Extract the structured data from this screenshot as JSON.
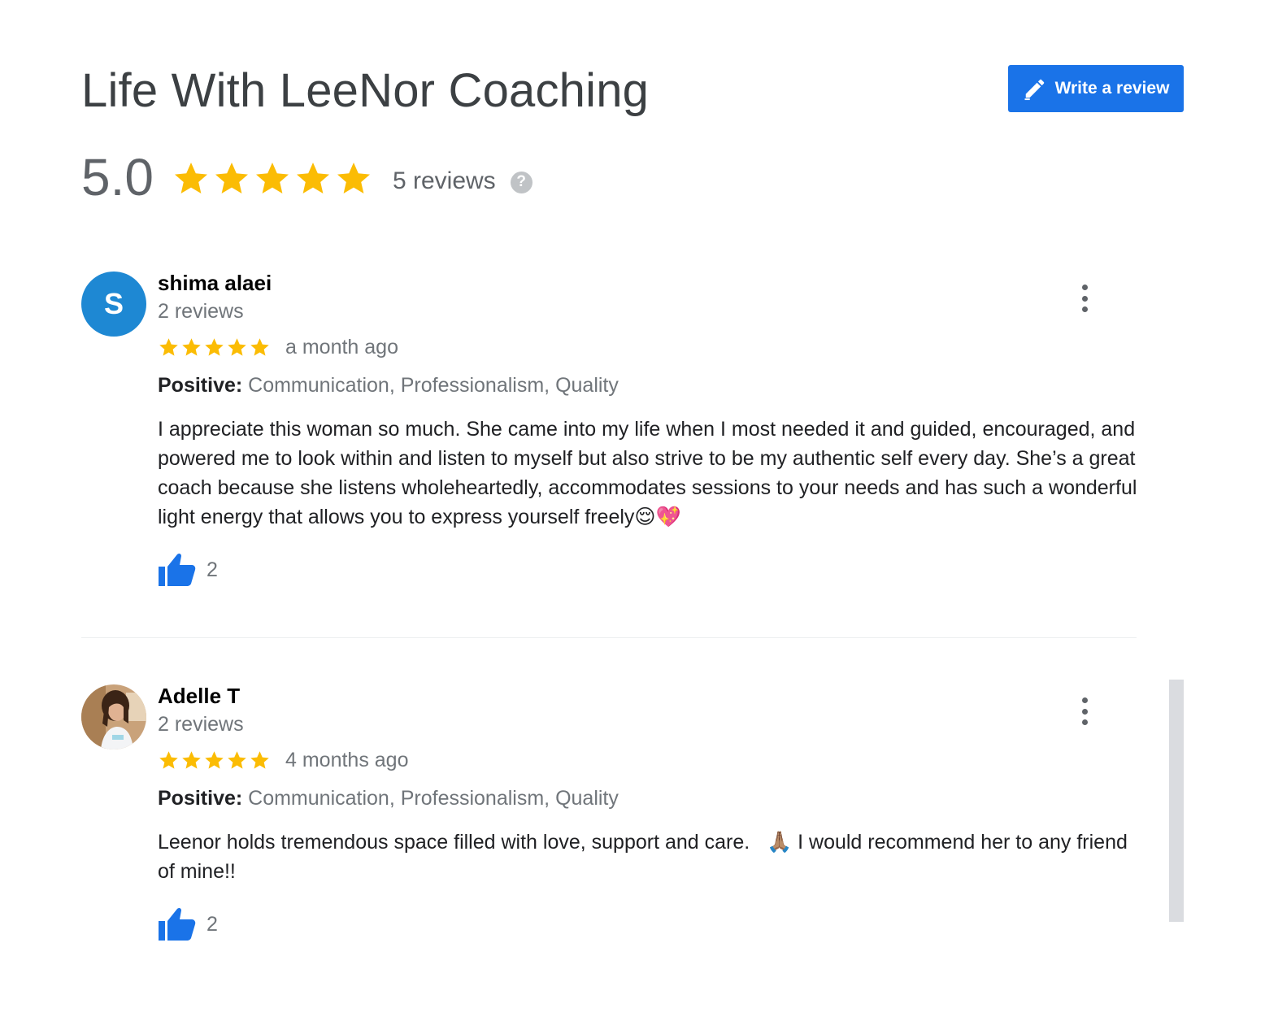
{
  "business": {
    "name": "Life With LeeNor Coaching",
    "rating": "5.0",
    "star_count": 5,
    "total_reviews": "5 reviews",
    "help_icon": "?"
  },
  "write_review": {
    "label": "Write a review",
    "icon": "pencil-icon",
    "bg": "#1a73e8"
  },
  "colors": {
    "star": "#fbbc04",
    "like": "#1a73e8",
    "avatar_bg": "#1e88d3"
  },
  "reviews": [
    {
      "reviewer": "shima alaei",
      "avatar_letter": "S",
      "reviewer_reviews": "2 reviews",
      "stars": 5,
      "date": "a month ago",
      "attr_label": "Positive:",
      "attr_value": " Communication, Professionalism, Quality",
      "text": "I appreciate this woman so much. She came into my life when I most needed it and guided, encouraged, and powered me to look within and listen to myself but also strive to be my authentic self every day. She’s a great coach because she listens wholeheartedly, accommodates sessions to your needs and has such a wonderful light energy that allows you to express yourself freely😌💖",
      "likes": "2"
    },
    {
      "reviewer": "Adelle T",
      "avatar_image": "profile-photo",
      "reviewer_reviews": "2 reviews",
      "stars": 5,
      "date": "4 months ago",
      "attr_label": "Positive:",
      "attr_value": " Communication, Professionalism, Quality",
      "text": "Leenor holds tremendous space filled with love, support and care.   🙏🏽 I would recommend her to any friend of mine!!",
      "likes": "2"
    }
  ]
}
